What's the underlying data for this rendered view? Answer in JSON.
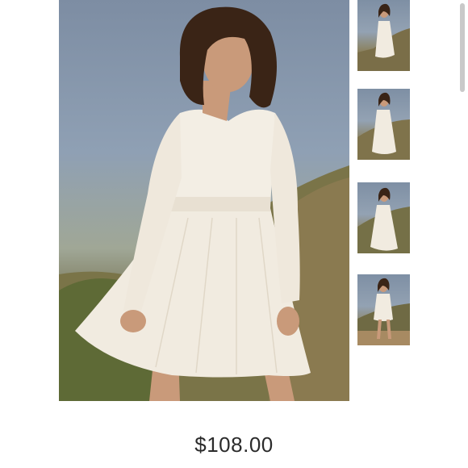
{
  "product": {
    "price": "$108.00"
  },
  "gallery": {
    "thumbnails": [
      {
        "alt": "model-front"
      },
      {
        "alt": "model-side"
      },
      {
        "alt": "model-wind"
      },
      {
        "alt": "model-full"
      }
    ]
  },
  "colors": {
    "sky": "#8fa0b4",
    "hill": "#6f6a48",
    "dress": "#f1ebe0",
    "hair": "#3a2416",
    "skin": "#c99a7a"
  }
}
